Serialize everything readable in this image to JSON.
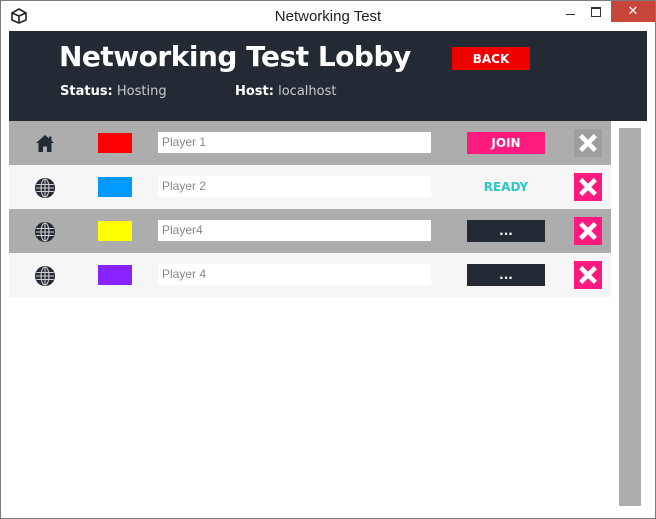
{
  "window": {
    "title": "Networking Test",
    "close_glyph": "✕"
  },
  "header": {
    "title": "Networking Test Lobby",
    "back_label": "BACK",
    "status_label": "Status:",
    "status_value": "Hosting",
    "host_label": "Host:",
    "host_value": "localhost"
  },
  "players": [
    {
      "icon": "home-icon",
      "color": "#ff0000",
      "name": "Player 1",
      "action": "JOIN",
      "action_style": "join",
      "remove_style": "gray"
    },
    {
      "icon": "globe-icon",
      "color": "#0099ff",
      "name": "Player 2",
      "action": "READY",
      "action_style": "ready",
      "remove_style": "pink"
    },
    {
      "icon": "globe-icon",
      "color": "#ffff00",
      "name": "Player4",
      "action": "...",
      "action_style": "wait",
      "remove_style": "pink"
    },
    {
      "icon": "globe-icon",
      "color": "#8822ff",
      "name": "Player 4",
      "action": "...",
      "action_style": "wait",
      "remove_style": "pink"
    }
  ],
  "colors": {
    "header_bg": "#232a33",
    "accent_pink": "#ff1a7f",
    "back_red": "#ee0000",
    "ready_teal": "#2bc6c6"
  }
}
